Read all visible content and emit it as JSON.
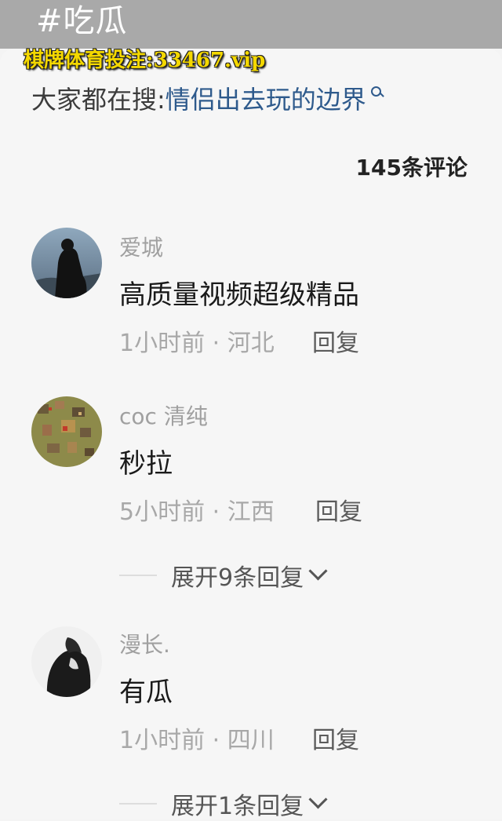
{
  "header": {
    "topic": "#吃瓜"
  },
  "watermark": {
    "text": "棋牌体育投注:33467.vip"
  },
  "search": {
    "prefix": "大家都在搜:",
    "term": "情侣出去玩的边界"
  },
  "comments_header": {
    "count_label": "145条评论"
  },
  "comments": [
    {
      "username": "爱城",
      "content": "高质量视频超级精品",
      "time": "1小时前",
      "location": "河北",
      "meta": "1小时前 · 河北",
      "reply_label": "回复"
    },
    {
      "username": "coc 清纯",
      "content": "秒拉",
      "time": "5小时前",
      "location": "江西",
      "meta": "5小时前 · 江西",
      "reply_label": "回复",
      "expand_label": "展开9条回复"
    },
    {
      "username": "漫长.",
      "content": "有瓜",
      "time": "1小时前",
      "location": "四川",
      "meta": "1小时前 · 四川",
      "reply_label": "回复",
      "expand_label": "展开1条回复"
    }
  ]
}
